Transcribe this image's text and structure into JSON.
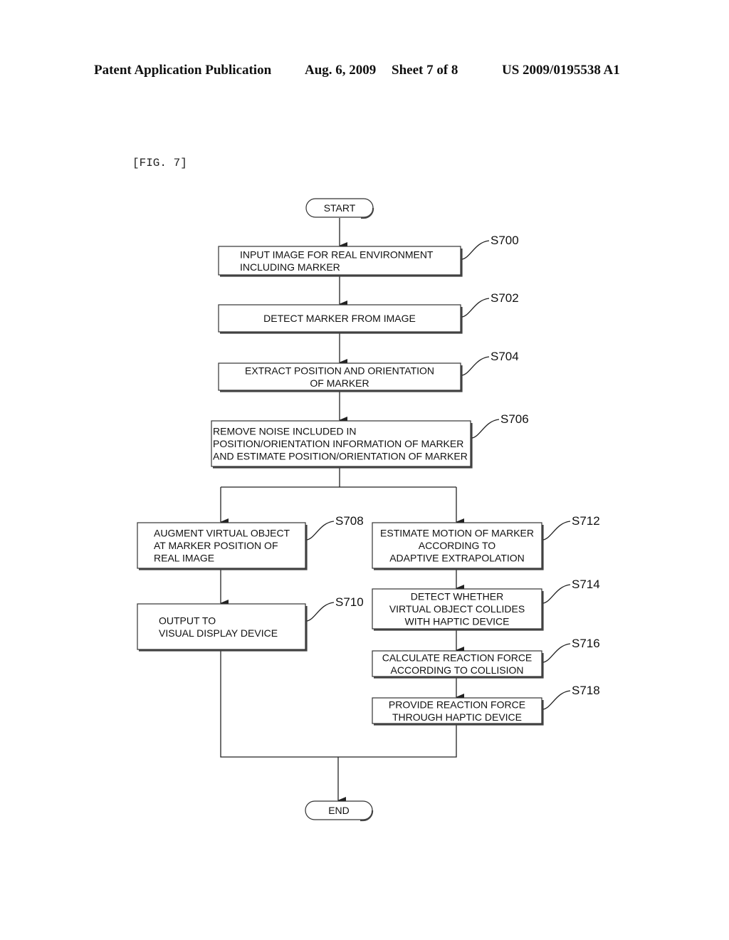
{
  "header": {
    "left": "Patent Application Publication",
    "date": "Aug. 6, 2009",
    "sheet": "Sheet 7 of 8",
    "number": "US 2009/0195538 A1"
  },
  "figure_label": "[FIG. 7]",
  "flowchart": {
    "start": "START",
    "end": "END",
    "steps": {
      "s700": {
        "id": "S700",
        "lines": [
          "INPUT IMAGE FOR REAL ENVIRONMENT",
          "INCLUDING MARKER"
        ]
      },
      "s702": {
        "id": "S702",
        "lines": [
          "DETECT MARKER FROM IMAGE"
        ]
      },
      "s704": {
        "id": "S704",
        "lines": [
          "EXTRACT POSITION AND ORIENTATION",
          "OF MARKER"
        ]
      },
      "s706": {
        "id": "S706",
        "lines": [
          "REMOVE NOISE INCLUDED IN",
          "POSITION/ORIENTATION INFORMATION OF MARKER",
          "AND ESTIMATE POSITION/ORIENTATION OF MARKER"
        ]
      },
      "s708": {
        "id": "S708",
        "lines": [
          "AUGMENT VIRTUAL OBJECT",
          "AT MARKER POSITION OF",
          "REAL IMAGE"
        ]
      },
      "s710": {
        "id": "S710",
        "lines": [
          "OUTPUT TO",
          "VISUAL DISPLAY DEVICE"
        ]
      },
      "s712": {
        "id": "S712",
        "lines": [
          "ESTIMATE MOTION OF MARKER",
          "ACCORDING TO",
          "ADAPTIVE EXTRAPOLATION"
        ]
      },
      "s714": {
        "id": "S714",
        "lines": [
          "DETECT WHETHER",
          "VIRTUAL OBJECT COLLIDES",
          "WITH HAPTIC DEVICE"
        ]
      },
      "s716": {
        "id": "S716",
        "lines": [
          "CALCULATE REACTION FORCE",
          "ACCORDING TO COLLISION"
        ]
      },
      "s718": {
        "id": "S718",
        "lines": [
          "PROVIDE REACTION FORCE",
          "THROUGH HAPTIC DEVICE"
        ]
      }
    }
  }
}
